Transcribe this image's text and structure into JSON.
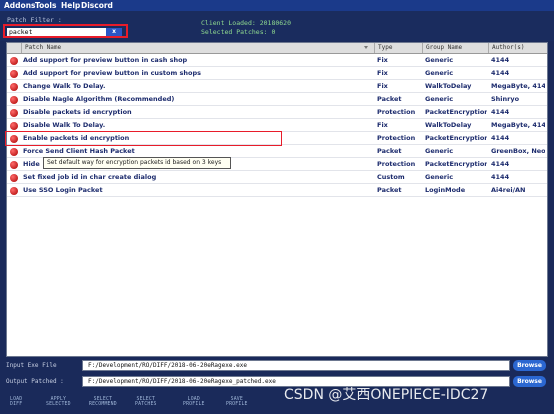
{
  "menu": [
    "Addons",
    "Tools",
    "Help",
    "Discord"
  ],
  "filter": {
    "label": "Patch Filter :",
    "value": "packet",
    "button_label": "x"
  },
  "status": {
    "client_loaded": "Client Loaded: 20180620",
    "selected_patches": "Selected Patches: 0"
  },
  "table": {
    "headers": {
      "name": "Patch Name",
      "type": "Type",
      "group": "Group Name",
      "author": "Author(s)"
    },
    "rows": [
      {
        "name": "Add support for preview button in cash shop",
        "type": "Fix",
        "group": "Generic",
        "author": "4144"
      },
      {
        "name": "Add support for preview button in custom shops",
        "type": "Fix",
        "group": "Generic",
        "author": "4144"
      },
      {
        "name": "Change Walk To Delay.",
        "type": "Fix",
        "group": "WalkToDelay",
        "author": "MegaByte, 4144"
      },
      {
        "name": "Disable Nagle Algorithm (Recommended)",
        "type": "Packet",
        "group": "Generic",
        "author": "Shinryo"
      },
      {
        "name": "Disable packets id encryption",
        "type": "Protection",
        "group": "PacketEncryption",
        "author": "4144"
      },
      {
        "name": "Disable Walk To Delay.",
        "type": "Fix",
        "group": "WalkToDelay",
        "author": "MegaByte, 4144"
      },
      {
        "name": "Enable packets id encryption",
        "type": "Protection",
        "group": "PacketEncryption",
        "author": "4144"
      },
      {
        "name": "Force Send Client Hash Packet",
        "type": "Packet",
        "group": "Generic",
        "author": "GreenBox, Neo"
      },
      {
        "name": "Hide",
        "type": "Protection",
        "group": "PacketEncryption",
        "author": "4144"
      },
      {
        "name": "Set fixed job id in char create dialog",
        "type": "Custom",
        "group": "Generic",
        "author": "4144"
      },
      {
        "name": "Use SSO Login Packet",
        "type": "Packet",
        "group": "LoginMode",
        "author": "Ai4rei/AN"
      }
    ],
    "tooltip": "Set default way for encryption packets id based on 3 keys"
  },
  "input_exe": {
    "label": "Input Exe File",
    "value": "F:/Development/RO/DIFF/2018-06-20eRagexe.exe",
    "browse_label": "Browse"
  },
  "output_patched": {
    "label": "Output Patched :",
    "value": "F:/Development/RO/DIFF/2018-06-20eRagexe_patched.exe",
    "browse_label": "Browse"
  },
  "toolbar": [
    {
      "line1": "LOAD",
      "line2": "DIFF"
    },
    {
      "line1": "APPLY",
      "line2": "SELECTED"
    },
    {
      "line1": "SELECT",
      "line2": "RECOMMEND"
    },
    {
      "line1": "SELECT",
      "line2": "PATCHES"
    },
    {
      "line1": "LOAD",
      "line2": "PROFILE"
    },
    {
      "line1": "SAVE",
      "line2": "PROFILE"
    }
  ],
  "watermark": "CSDN @艾西ONEPIECE-IDC27"
}
